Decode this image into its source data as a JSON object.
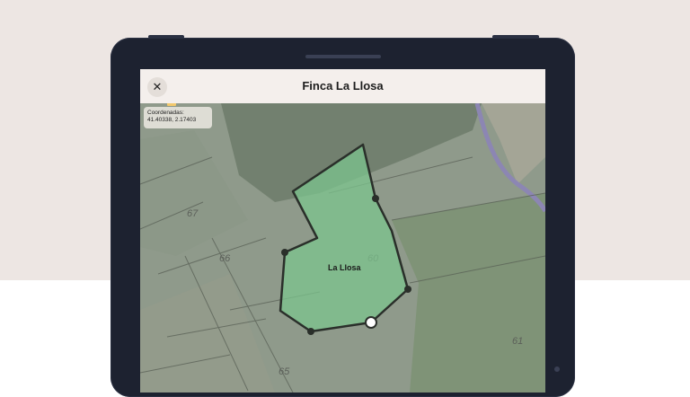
{
  "header": {
    "title": "Finca La Llosa",
    "close_icon": "close-icon"
  },
  "coordinates": {
    "label": "Coordenadas:",
    "value": "41.40338, 2.17403"
  },
  "map": {
    "parcel_label": "La Llosa",
    "plot_numbers": [
      "67",
      "66",
      "60",
      "65",
      "61"
    ]
  },
  "colors": {
    "parcel_fill": "#7cc48e",
    "parcel_stroke": "#2a2f2a",
    "header_bg": "#f4efec",
    "device": "#1d2230"
  }
}
